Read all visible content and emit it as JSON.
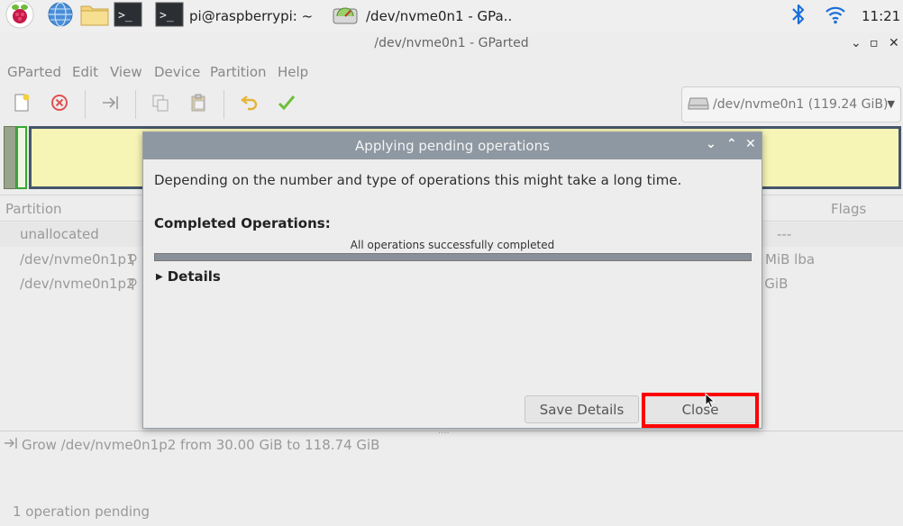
{
  "taskbar": {
    "terminal_label": "pi@raspberrypi: ~",
    "gparted_task_label": "/dev/nvme0n1 - GPa..",
    "clock": "11:21"
  },
  "window": {
    "title": "/dev/nvme0n1 - GParted"
  },
  "menu": [
    "GParted",
    "Edit",
    "View",
    "Device",
    "Partition",
    "Help"
  ],
  "device_select": {
    "label": "/dev/nvme0n1 (119.24 GiB)"
  },
  "partition_list": {
    "headers": {
      "partition": "Partition",
      "flags": "Flags"
    },
    "rows": [
      {
        "name": "unallocated",
        "right": "---"
      },
      {
        "name": "/dev/nvme0n1p1",
        "right": "MiB  lba"
      },
      {
        "name": "/dev/nvme0n1p2",
        "right": "0 GiB"
      }
    ]
  },
  "operations": {
    "items": [
      "Grow /dev/nvme0n1p2 from 30.00 GiB to 118.74 GiB"
    ],
    "status": "1 operation pending"
  },
  "dialog": {
    "title": "Applying pending operations",
    "description": "Depending on the number and type of operations this might take a long time.",
    "completed_label": "Completed Operations:",
    "progress_label": "All operations successfully completed",
    "progress": 1.0,
    "details_label": "Details",
    "save_details_label": "Save Details",
    "close_label": "Close"
  },
  "colors": {
    "highlight": "#ff0000",
    "graph_fill": "#f7f5b5",
    "graph_border": "#44566a",
    "dialog_titlebar": "#8e98a2"
  },
  "icons": [
    "raspberry-icon",
    "globe-icon",
    "folder-icon",
    "terminal-icon",
    "gparted-icon",
    "bluetooth-icon",
    "wifi-icon"
  ]
}
